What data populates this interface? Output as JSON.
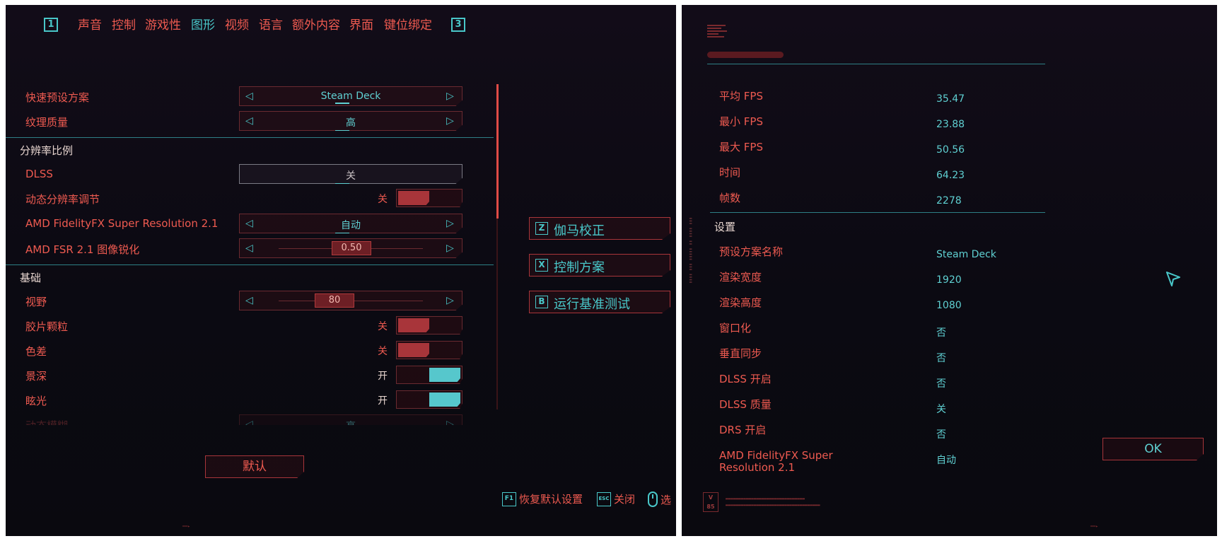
{
  "tabs": {
    "left_key": "1",
    "right_key": "3",
    "items": [
      {
        "label": "声音",
        "active": false
      },
      {
        "label": "控制",
        "active": false
      },
      {
        "label": "游戏性",
        "active": false
      },
      {
        "label": "图形",
        "active": true
      },
      {
        "label": "视频",
        "active": false
      },
      {
        "label": "语言",
        "active": false
      },
      {
        "label": "额外内容",
        "active": false
      },
      {
        "label": "界面",
        "active": false
      },
      {
        "label": "键位绑定",
        "active": false
      }
    ]
  },
  "settings": {
    "quick_preset": {
      "label": "快速预设方案",
      "value": "Steam Deck"
    },
    "texture_quality": {
      "label": "纹理质量",
      "value": "高"
    },
    "section_resolution": "分辨率比例",
    "dlss": {
      "label": "DLSS",
      "value": "关"
    },
    "dynamic_resolution": {
      "label": "动态分辨率调节",
      "state": "关"
    },
    "fsr": {
      "label": "AMD FidelityFX Super Resolution 2.1",
      "value": "自动"
    },
    "fsr_sharpness": {
      "label": "AMD FSR 2.1 图像锐化",
      "value": "0.50"
    },
    "section_basic": "基础",
    "fov": {
      "label": "视野",
      "value": "80"
    },
    "film_grain": {
      "label": "胶片颗粒",
      "state": "关"
    },
    "chromatic_aberration": {
      "label": "色差",
      "state": "关"
    },
    "depth_of_field": {
      "label": "景深",
      "state": "开"
    },
    "lens_flare": {
      "label": "眩光",
      "state": "开"
    },
    "motion_blur": {
      "label": "动态模糊",
      "value": "高"
    }
  },
  "side_buttons": {
    "gamma": {
      "key": "Z",
      "label": "伽马校正"
    },
    "control_scheme": {
      "key": "X",
      "label": "控制方案"
    },
    "benchmark": {
      "key": "B",
      "label": "运行基准测试"
    }
  },
  "default_button": "默认",
  "footer": {
    "restore_key": "F1",
    "restore_label": "恢复默认设置",
    "close_key": "ESC",
    "close_label": "关闭",
    "select_label": "选"
  },
  "results": {
    "stats": [
      {
        "label": "平均 FPS",
        "value": "35.47"
      },
      {
        "label": "最小 FPS",
        "value": "23.88"
      },
      {
        "label": "最大 FPS",
        "value": "50.56"
      },
      {
        "label": "时间",
        "value": "64.23"
      },
      {
        "label": "帧数",
        "value": "2278"
      }
    ],
    "settings_title": "设置",
    "settings": [
      {
        "label": "预设方案名称",
        "value": "Steam Deck"
      },
      {
        "label": "渲染宽度",
        "value": "1920"
      },
      {
        "label": "渲染高度",
        "value": "1080"
      },
      {
        "label": "窗口化",
        "value": "否"
      },
      {
        "label": "垂直同步",
        "value": "否"
      },
      {
        "label": "DLSS 开启",
        "value": "否"
      },
      {
        "label": "DLSS 质量",
        "value": "关"
      },
      {
        "label": "DRS 开启",
        "value": "否"
      },
      {
        "label": "AMD FidelityFX Super Resolution 2.1",
        "value": "自动"
      }
    ],
    "ok_button": "OK",
    "version_badge": "V 85"
  },
  "colors": {
    "accent_cyan": "#49c7c9",
    "accent_red": "#ee5a50",
    "panel_bg": "#0b0a12"
  }
}
